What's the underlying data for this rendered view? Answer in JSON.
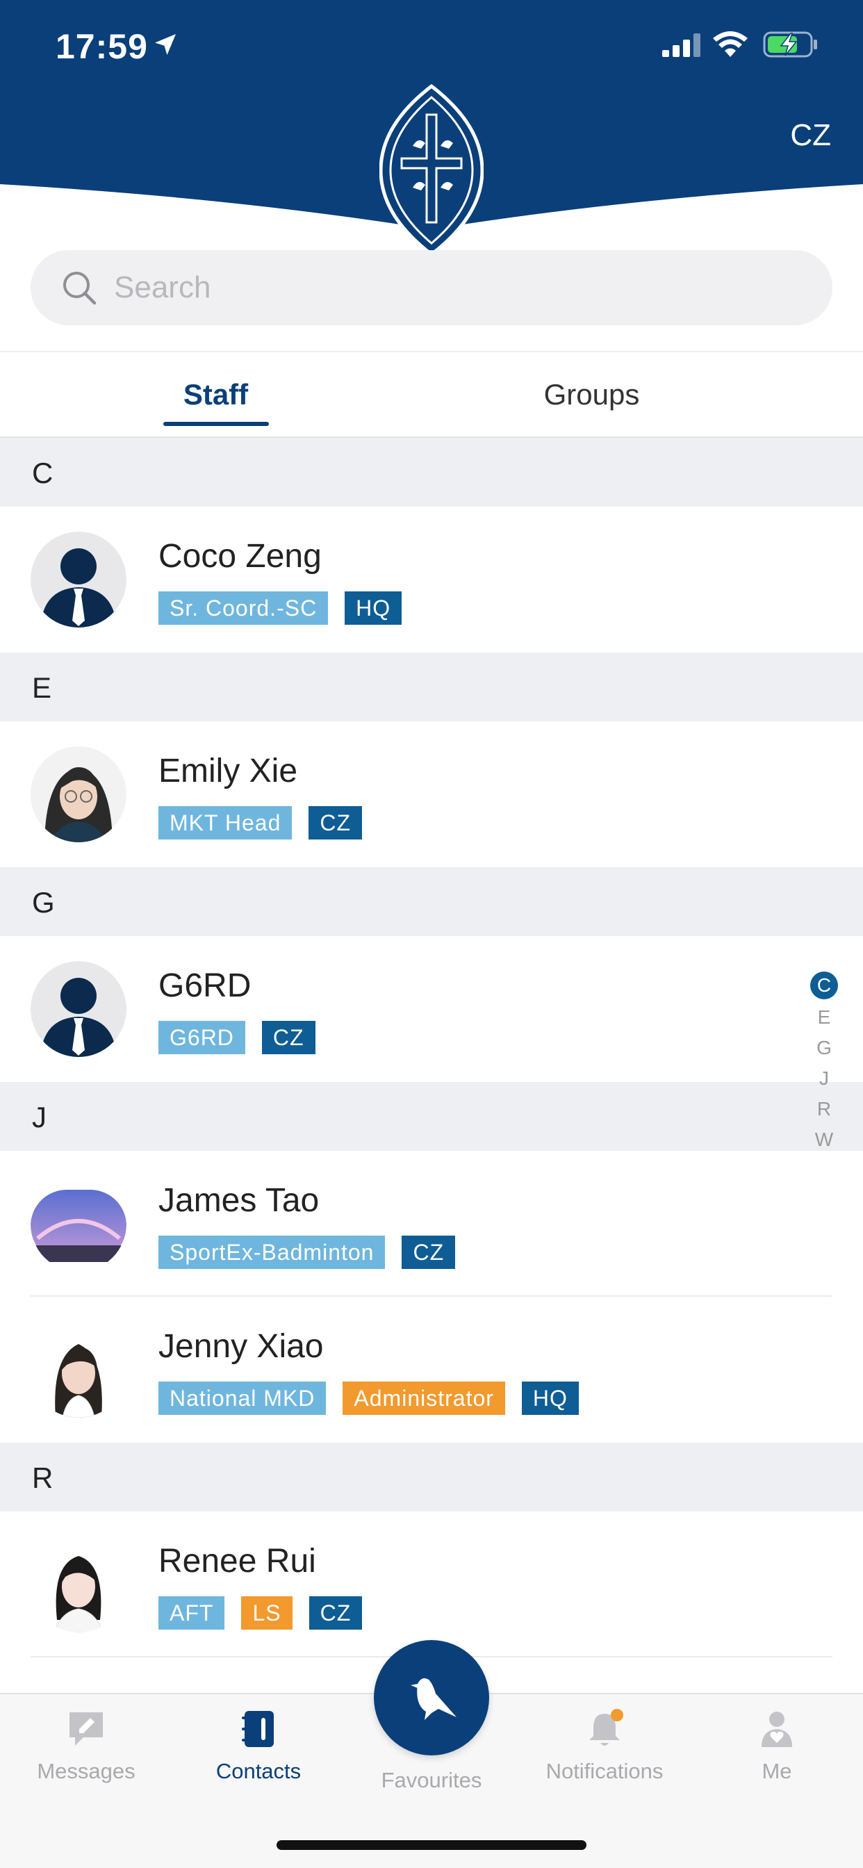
{
  "status_bar": {
    "time": "17:59"
  },
  "header": {
    "campus_code": "CZ",
    "brand_color": "#0a3f7a"
  },
  "search": {
    "placeholder": "Search",
    "value": ""
  },
  "tabs": [
    {
      "label": "Staff",
      "active": true
    },
    {
      "label": "Groups",
      "active": false
    }
  ],
  "sections": [
    {
      "letter": "C",
      "contacts": [
        {
          "name": "Coco Zeng",
          "avatar": "default-person-icon",
          "tags": [
            {
              "label": "Sr. Coord.-SC",
              "style": "light"
            },
            {
              "label": "HQ",
              "style": "dark"
            }
          ]
        }
      ]
    },
    {
      "letter": "E",
      "contacts": [
        {
          "name": "Emily Xie",
          "avatar": "photo",
          "tags": [
            {
              "label": "MKT Head",
              "style": "light"
            },
            {
              "label": "CZ",
              "style": "dark"
            }
          ]
        }
      ]
    },
    {
      "letter": "G",
      "contacts": [
        {
          "name": "G6RD",
          "avatar": "default-person-icon",
          "tags": [
            {
              "label": "G6RD",
              "style": "light"
            },
            {
              "label": "CZ",
              "style": "dark"
            }
          ]
        }
      ]
    },
    {
      "letter": "J",
      "contacts": [
        {
          "name": "James Tao",
          "avatar": "photo",
          "tags": [
            {
              "label": "SportEx-Badminton",
              "style": "light"
            },
            {
              "label": "CZ",
              "style": "dark"
            }
          ]
        },
        {
          "name": "Jenny Xiao",
          "avatar": "photo",
          "tags": [
            {
              "label": "National MKD",
              "style": "light"
            },
            {
              "label": "Administrator",
              "style": "orange"
            },
            {
              "label": "HQ",
              "style": "dark"
            }
          ]
        }
      ]
    },
    {
      "letter": "R",
      "contacts": [
        {
          "name": "Renee Rui",
          "avatar": "photo",
          "tags": [
            {
              "label": "AFT",
              "style": "light"
            },
            {
              "label": "LS",
              "style": "orange"
            },
            {
              "label": "CZ",
              "style": "dark"
            }
          ]
        }
      ]
    }
  ],
  "az_index": [
    "C",
    "E",
    "G",
    "J",
    "R",
    "W"
  ],
  "az_active": "C",
  "tabbar": {
    "messages": "Messages",
    "contacts": "Contacts",
    "favourites": "Favourites",
    "notifications": "Notifications",
    "me": "Me"
  },
  "colors": {
    "tag_light": "#6fb6de",
    "tag_dark": "#0e5d95",
    "tag_orange": "#f29a2e",
    "notification_dot": "#f29a2e"
  }
}
